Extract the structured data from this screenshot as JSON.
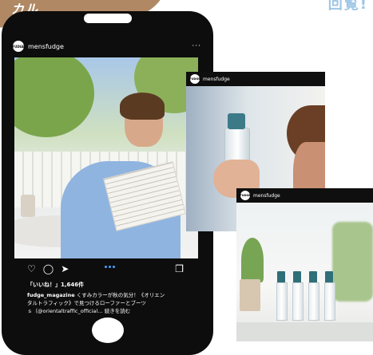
{
  "banner": {
    "top_left_text": "カル",
    "top_right_text": "回覧!"
  },
  "post": {
    "handle": "mensfudge",
    "avatar_text": "FUDGE",
    "more": "···",
    "likes": "「いいね！」1,646件",
    "caption_user": "fudge_magazine",
    "caption_text": " くすみカラーが秋の気分！《オリエン\nタルトラフィック》で見つけるローファーとブーツ\nｓ（@orientaltraffic_official… 続きを読む"
  },
  "cards": [
    {
      "handle": "mensfudge",
      "avatar_text": "FUDGE"
    },
    {
      "handle": "mensfudge",
      "avatar_text": "FUDGE"
    }
  ],
  "icons": {
    "like": "heart-icon",
    "comment": "comment-icon",
    "share": "share-icon",
    "save": "bookmark-icon"
  },
  "colors": {
    "accent_brown": "#b08864",
    "light_blue": "#9ec6e4",
    "phone": "#0d0d0d"
  }
}
